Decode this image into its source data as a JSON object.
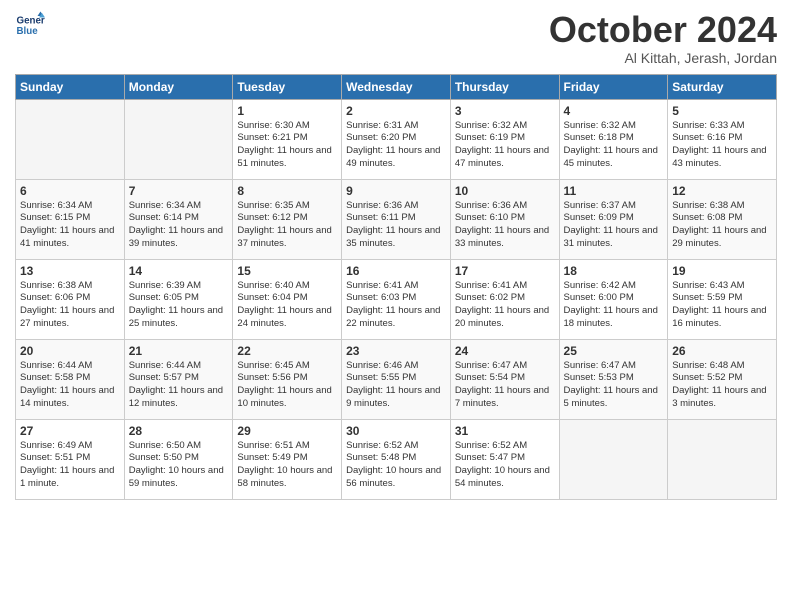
{
  "header": {
    "logo_line1": "General",
    "logo_line2": "Blue",
    "month": "October 2024",
    "location": "Al Kittah, Jerash, Jordan"
  },
  "days_of_week": [
    "Sunday",
    "Monday",
    "Tuesday",
    "Wednesday",
    "Thursday",
    "Friday",
    "Saturday"
  ],
  "weeks": [
    [
      {
        "day": "",
        "empty": true
      },
      {
        "day": "",
        "empty": true
      },
      {
        "day": "1",
        "line1": "Sunrise: 6:30 AM",
        "line2": "Sunset: 6:21 PM",
        "line3": "Daylight: 11 hours and 51 minutes."
      },
      {
        "day": "2",
        "line1": "Sunrise: 6:31 AM",
        "line2": "Sunset: 6:20 PM",
        "line3": "Daylight: 11 hours and 49 minutes."
      },
      {
        "day": "3",
        "line1": "Sunrise: 6:32 AM",
        "line2": "Sunset: 6:19 PM",
        "line3": "Daylight: 11 hours and 47 minutes."
      },
      {
        "day": "4",
        "line1": "Sunrise: 6:32 AM",
        "line2": "Sunset: 6:18 PM",
        "line3": "Daylight: 11 hours and 45 minutes."
      },
      {
        "day": "5",
        "line1": "Sunrise: 6:33 AM",
        "line2": "Sunset: 6:16 PM",
        "line3": "Daylight: 11 hours and 43 minutes."
      }
    ],
    [
      {
        "day": "6",
        "line1": "Sunrise: 6:34 AM",
        "line2": "Sunset: 6:15 PM",
        "line3": "Daylight: 11 hours and 41 minutes."
      },
      {
        "day": "7",
        "line1": "Sunrise: 6:34 AM",
        "line2": "Sunset: 6:14 PM",
        "line3": "Daylight: 11 hours and 39 minutes."
      },
      {
        "day": "8",
        "line1": "Sunrise: 6:35 AM",
        "line2": "Sunset: 6:12 PM",
        "line3": "Daylight: 11 hours and 37 minutes."
      },
      {
        "day": "9",
        "line1": "Sunrise: 6:36 AM",
        "line2": "Sunset: 6:11 PM",
        "line3": "Daylight: 11 hours and 35 minutes."
      },
      {
        "day": "10",
        "line1": "Sunrise: 6:36 AM",
        "line2": "Sunset: 6:10 PM",
        "line3": "Daylight: 11 hours and 33 minutes."
      },
      {
        "day": "11",
        "line1": "Sunrise: 6:37 AM",
        "line2": "Sunset: 6:09 PM",
        "line3": "Daylight: 11 hours and 31 minutes."
      },
      {
        "day": "12",
        "line1": "Sunrise: 6:38 AM",
        "line2": "Sunset: 6:08 PM",
        "line3": "Daylight: 11 hours and 29 minutes."
      }
    ],
    [
      {
        "day": "13",
        "line1": "Sunrise: 6:38 AM",
        "line2": "Sunset: 6:06 PM",
        "line3": "Daylight: 11 hours and 27 minutes."
      },
      {
        "day": "14",
        "line1": "Sunrise: 6:39 AM",
        "line2": "Sunset: 6:05 PM",
        "line3": "Daylight: 11 hours and 25 minutes."
      },
      {
        "day": "15",
        "line1": "Sunrise: 6:40 AM",
        "line2": "Sunset: 6:04 PM",
        "line3": "Daylight: 11 hours and 24 minutes."
      },
      {
        "day": "16",
        "line1": "Sunrise: 6:41 AM",
        "line2": "Sunset: 6:03 PM",
        "line3": "Daylight: 11 hours and 22 minutes."
      },
      {
        "day": "17",
        "line1": "Sunrise: 6:41 AM",
        "line2": "Sunset: 6:02 PM",
        "line3": "Daylight: 11 hours and 20 minutes."
      },
      {
        "day": "18",
        "line1": "Sunrise: 6:42 AM",
        "line2": "Sunset: 6:00 PM",
        "line3": "Daylight: 11 hours and 18 minutes."
      },
      {
        "day": "19",
        "line1": "Sunrise: 6:43 AM",
        "line2": "Sunset: 5:59 PM",
        "line3": "Daylight: 11 hours and 16 minutes."
      }
    ],
    [
      {
        "day": "20",
        "line1": "Sunrise: 6:44 AM",
        "line2": "Sunset: 5:58 PM",
        "line3": "Daylight: 11 hours and 14 minutes."
      },
      {
        "day": "21",
        "line1": "Sunrise: 6:44 AM",
        "line2": "Sunset: 5:57 PM",
        "line3": "Daylight: 11 hours and 12 minutes."
      },
      {
        "day": "22",
        "line1": "Sunrise: 6:45 AM",
        "line2": "Sunset: 5:56 PM",
        "line3": "Daylight: 11 hours and 10 minutes."
      },
      {
        "day": "23",
        "line1": "Sunrise: 6:46 AM",
        "line2": "Sunset: 5:55 PM",
        "line3": "Daylight: 11 hours and 9 minutes."
      },
      {
        "day": "24",
        "line1": "Sunrise: 6:47 AM",
        "line2": "Sunset: 5:54 PM",
        "line3": "Daylight: 11 hours and 7 minutes."
      },
      {
        "day": "25",
        "line1": "Sunrise: 6:47 AM",
        "line2": "Sunset: 5:53 PM",
        "line3": "Daylight: 11 hours and 5 minutes."
      },
      {
        "day": "26",
        "line1": "Sunrise: 6:48 AM",
        "line2": "Sunset: 5:52 PM",
        "line3": "Daylight: 11 hours and 3 minutes."
      }
    ],
    [
      {
        "day": "27",
        "line1": "Sunrise: 6:49 AM",
        "line2": "Sunset: 5:51 PM",
        "line3": "Daylight: 11 hours and 1 minute."
      },
      {
        "day": "28",
        "line1": "Sunrise: 6:50 AM",
        "line2": "Sunset: 5:50 PM",
        "line3": "Daylight: 10 hours and 59 minutes."
      },
      {
        "day": "29",
        "line1": "Sunrise: 6:51 AM",
        "line2": "Sunset: 5:49 PM",
        "line3": "Daylight: 10 hours and 58 minutes."
      },
      {
        "day": "30",
        "line1": "Sunrise: 6:52 AM",
        "line2": "Sunset: 5:48 PM",
        "line3": "Daylight: 10 hours and 56 minutes."
      },
      {
        "day": "31",
        "line1": "Sunrise: 6:52 AM",
        "line2": "Sunset: 5:47 PM",
        "line3": "Daylight: 10 hours and 54 minutes."
      },
      {
        "day": "",
        "empty": true
      },
      {
        "day": "",
        "empty": true
      }
    ]
  ]
}
